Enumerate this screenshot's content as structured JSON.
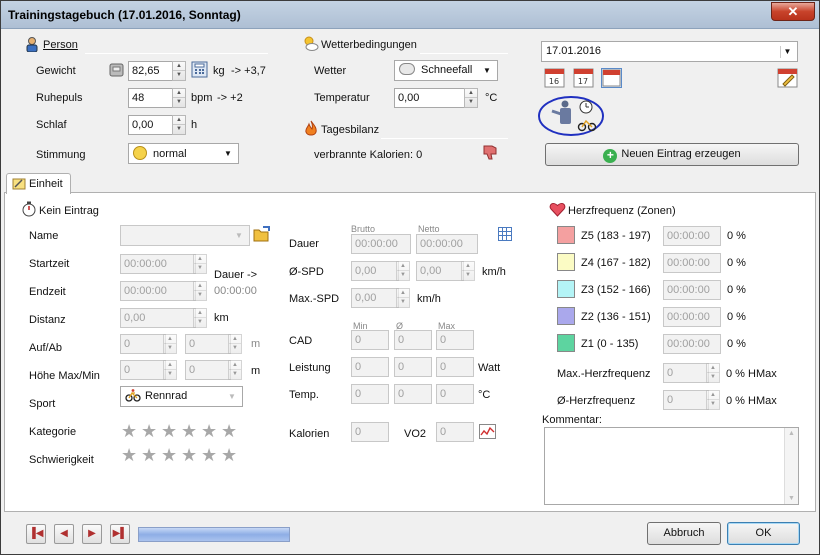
{
  "window": {
    "title": "Trainingstagebuch (17.01.2016, Sonntag)",
    "close_label": "✕"
  },
  "person": {
    "header": "Person",
    "weight_label": "Gewicht",
    "weight_value": "82,65",
    "weight_unit": "kg",
    "weight_delta": "-> +3,7",
    "pulse_label": "Ruhepuls",
    "pulse_value": "48",
    "pulse_unit": "bpm",
    "pulse_delta": "-> +2",
    "sleep_label": "Schlaf",
    "sleep_value": "0,00",
    "sleep_unit": "h",
    "mood_label": "Stimmung",
    "mood_value": "normal"
  },
  "weather": {
    "header": "Wetterbedingungen",
    "weather_label": "Wetter",
    "weather_value": "Schneefall",
    "temp_label": "Temperatur",
    "temp_value": "0,00",
    "temp_unit": "°C"
  },
  "balance": {
    "header": "Tagesbilanz",
    "calories_text": "verbrannte Kalorien: 0"
  },
  "date": {
    "value": "17.01.2016"
  },
  "new_entry_label": "Neuen Eintrag erzeugen",
  "tab": {
    "label": "Einheit"
  },
  "entry": {
    "header": "Kein Eintrag",
    "name_label": "Name",
    "start_label": "Startzeit",
    "start_value": "00:00:00",
    "end_label": "Endzeit",
    "end_value": "00:00:00",
    "duration_arrow": "Dauer ->",
    "duration_value": "00:00:00",
    "distance_label": "Distanz",
    "distance_value": "0,00",
    "distance_unit": "km",
    "updown_label": "Auf/Ab",
    "updown_value1": "0",
    "updown_value2": "0",
    "updown_unit": "m",
    "height_label": "Höhe Max/Min",
    "height_value1": "0",
    "height_value2": "0",
    "height_unit": "m",
    "sport_label": "Sport",
    "sport_value": "Rennrad",
    "category_label": "Kategorie",
    "difficulty_label": "Schwierigkeit"
  },
  "metrics": {
    "brutto_label": "Brutto",
    "netto_label": "Netto",
    "duration_label": "Dauer",
    "duration_brutto": "00:00:00",
    "duration_netto": "00:00:00",
    "avg_speed_label": "Ø-SPD",
    "avg_speed_brutto": "0,00",
    "avg_speed_netto": "0,00",
    "speed_unit": "km/h",
    "max_speed_label": "Max.-SPD",
    "max_speed_value": "0,00",
    "max_speed_unit": "km/h",
    "min_label": "Min",
    "avg_label": "Ø",
    "max_label": "Max",
    "cad_label": "CAD",
    "cad_min": "0",
    "cad_avg": "0",
    "cad_max": "0",
    "power_label": "Leistung",
    "power_min": "0",
    "power_avg": "0",
    "power_max": "0",
    "power_unit": "Watt",
    "temp_label": "Temp.",
    "temp_min": "0",
    "temp_avg": "0",
    "temp_max": "0",
    "temp_unit": "°C",
    "calories_label": "Kalorien",
    "calories_value": "0",
    "vo2_label": "VO2",
    "vo2_value": "0"
  },
  "heartrate": {
    "header": "Herzfrequenz (Zonen)",
    "zones": [
      {
        "label": "Z5 (183 - 197)",
        "time": "00:00:00",
        "pct": "0 %",
        "color": "#f4a0a0"
      },
      {
        "label": "Z4 (167 - 182)",
        "time": "00:00:00",
        "pct": "0 %",
        "color": "#fbfbc4"
      },
      {
        "label": "Z3 (152 - 166)",
        "time": "00:00:00",
        "pct": "0 %",
        "color": "#b4f4f6"
      },
      {
        "label": "Z2 (136 - 151)",
        "time": "00:00:00",
        "pct": "0 %",
        "color": "#aaa8ec"
      },
      {
        "label": "Z1 (0 - 135)",
        "time": "00:00:00",
        "pct": "0 %",
        "color": "#5dd4a0"
      }
    ],
    "max_label": "Max.-Herzfrequenz",
    "max_value": "0",
    "max_unit": "0 % HMax",
    "avg_label": "Ø-Herzfrequenz",
    "avg_value": "0",
    "avg_unit": "0 % HMax",
    "comment_label": "Kommentar:"
  },
  "footer": {
    "cancel_label": "Abbruch",
    "ok_label": "OK"
  }
}
